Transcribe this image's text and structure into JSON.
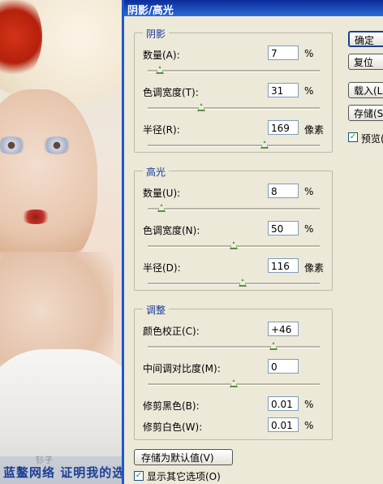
{
  "photo": {
    "watermark": "蓝鳌网络 证明我的选择",
    "small_mark": "钐子"
  },
  "dialog": {
    "title": "阴影/高光",
    "shadows": {
      "legend": "阴影",
      "amount_label": "数量(A):",
      "amount_value": "7",
      "amount_unit": "%",
      "amount_slider": 0.07,
      "tonal_label": "色调宽度(T):",
      "tonal_value": "31",
      "tonal_unit": "%",
      "tonal_slider": 0.31,
      "radius_label": "半径(R):",
      "radius_value": "169",
      "radius_unit": "像素",
      "radius_slider": 0.68
    },
    "highlights": {
      "legend": "高光",
      "amount_label": "数量(U):",
      "amount_value": "8",
      "amount_unit": "%",
      "amount_slider": 0.08,
      "tonal_label": "色调宽度(N):",
      "tonal_value": "50",
      "tonal_unit": "%",
      "tonal_slider": 0.5,
      "radius_label": "半径(D):",
      "radius_value": "116",
      "radius_unit": "像素",
      "radius_slider": 0.55
    },
    "adjustments": {
      "legend": "调整",
      "color_label": "颜色校正(C):",
      "color_value": "+46",
      "color_slider": 0.73,
      "midtone_label": "中间调对比度(M):",
      "midtone_value": "0",
      "midtone_slider": 0.5,
      "black_label": "修剪黑色(B):",
      "black_value": "0.01",
      "black_unit": "%",
      "white_label": "修剪白色(W):",
      "white_value": "0.01",
      "white_unit": "%"
    },
    "buttons": {
      "ok": "确定",
      "reset": "复位",
      "load": "载入(L)...",
      "save": "存储(S)...",
      "save_default": "存储为默认值(V)"
    },
    "preview_label": "预览(P)",
    "preview_checked": true,
    "more_options_label": "显示其它选项(O)",
    "more_options_checked": true
  }
}
